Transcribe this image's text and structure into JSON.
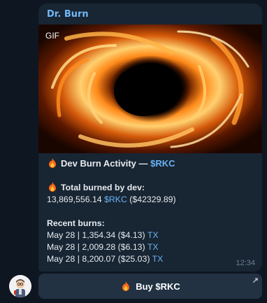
{
  "message": {
    "sender": "Dr. Burn",
    "media_badge": "GIF",
    "title_prefix": "Dev Burn Activity — ",
    "title_token": "$RKC",
    "total_label": "Total burned by dev:",
    "total_amount": "13,869,556.14",
    "total_token": "$RKC",
    "total_usd": "($42329.89)",
    "recent_label": "Recent burns:",
    "burns": [
      {
        "text": "May 28 | 1,354.34 ($4.13)",
        "link": "TX"
      },
      {
        "text": "May 28 | 2,009.28 ($6.13)",
        "link": "TX"
      },
      {
        "text": "May 28 | 8,200.07 ($25.03)",
        "link": "TX"
      }
    ],
    "time": "12:34"
  },
  "button": {
    "label": "Buy $RKC",
    "arrow": "↗"
  },
  "icons": {
    "fire": "fire-icon",
    "avatar": "bot-avatar",
    "link": "external-link-icon"
  },
  "colors": {
    "background": "#0e1621",
    "bubble": "#182533",
    "sender": "#71b8f5",
    "link": "#6ab3f3",
    "button": "#223243"
  }
}
